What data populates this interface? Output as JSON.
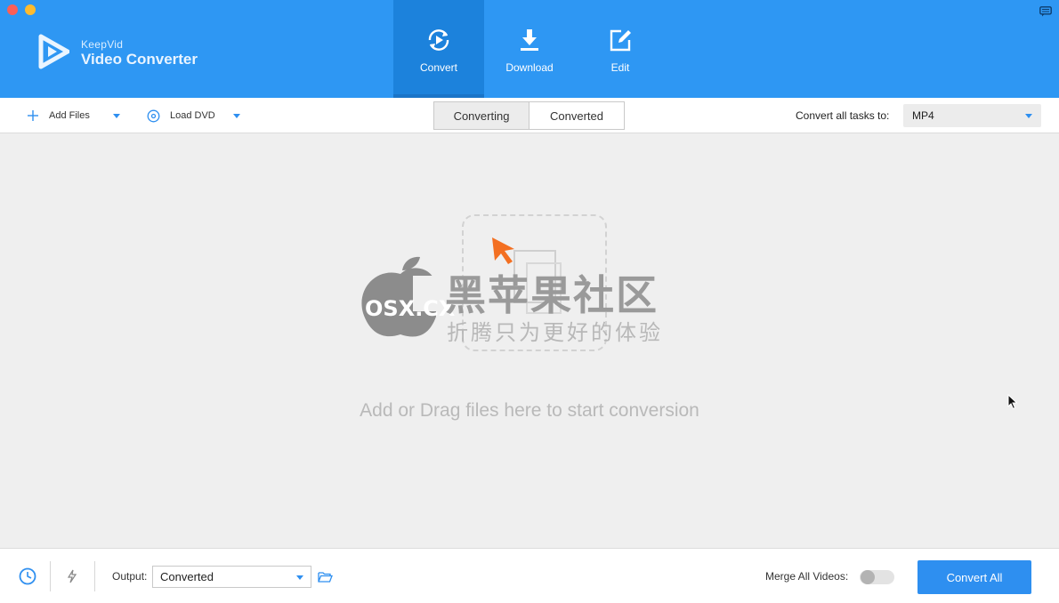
{
  "app": {
    "brand_small": "KeepVid",
    "brand_name": "Video Converter",
    "accent_color": "#2e97f3",
    "accent_dark": "#1c82dc"
  },
  "nav": {
    "tabs": [
      {
        "label": "Convert",
        "icon": "convert-icon",
        "active": true
      },
      {
        "label": "Download",
        "icon": "download-icon",
        "active": false
      },
      {
        "label": "Edit",
        "icon": "edit-icon",
        "active": false
      }
    ]
  },
  "toolbar": {
    "add_files_label": "Add Files",
    "load_dvd_label": "Load DVD",
    "segments": [
      {
        "label": "Converting",
        "active": true
      },
      {
        "label": "Converted",
        "active": false
      }
    ],
    "convert_all_label": "Convert all tasks to:",
    "format_value": "MP4"
  },
  "main": {
    "drop_hint": "Add or Drag files here to start conversion",
    "watermark_main": "黑苹果社区",
    "watermark_sub": "折腾只为更好的体验",
    "watermark_site": "OSX.CX"
  },
  "bottom": {
    "output_label": "Output:",
    "output_value": "Converted",
    "merge_label": "Merge All Videos:",
    "merge_enabled": false,
    "convert_all_button": "Convert All"
  }
}
